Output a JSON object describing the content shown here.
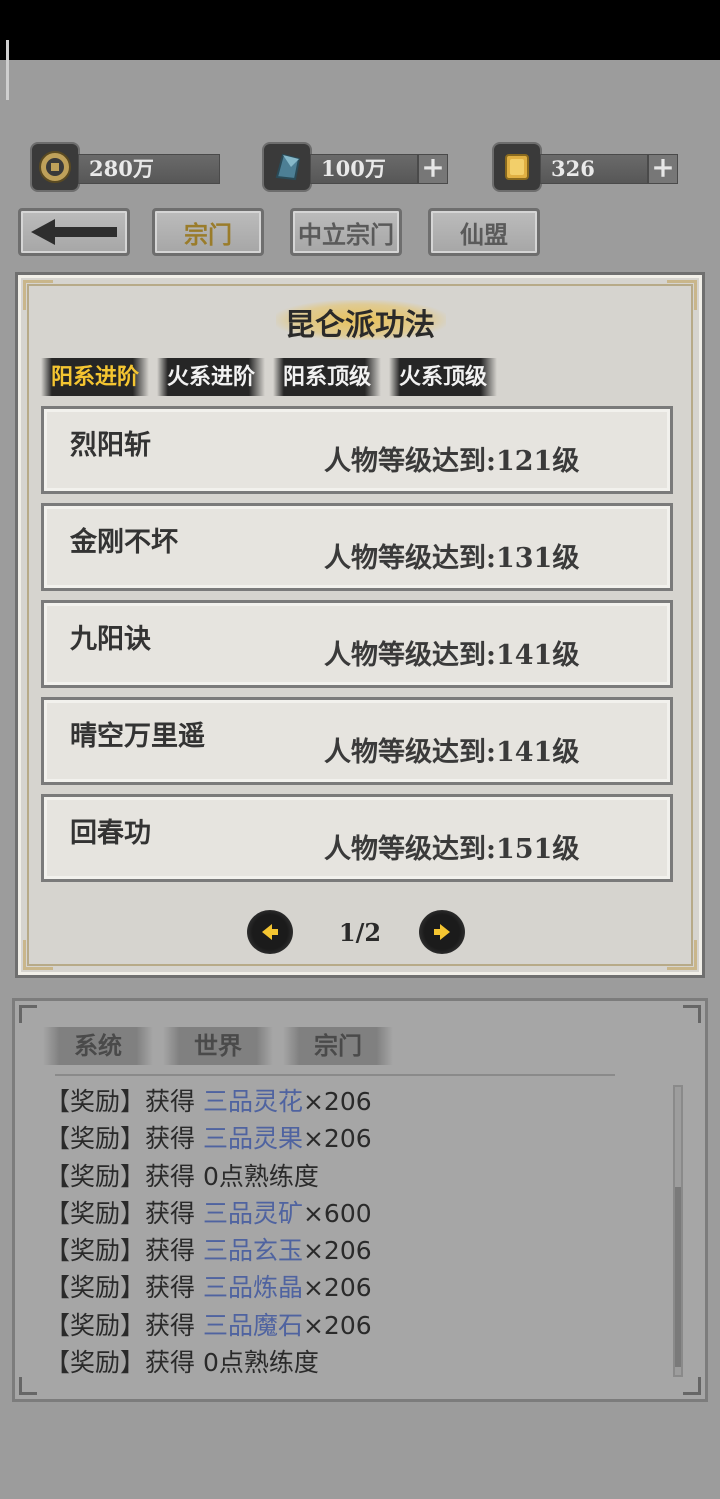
{
  "resources": [
    {
      "icon": "coin-icon",
      "value": "280万",
      "has_plus": false
    },
    {
      "icon": "crystal-icon",
      "value": "100万",
      "has_plus": true
    },
    {
      "icon": "gold-ingot-icon",
      "value": "326",
      "has_plus": true
    }
  ],
  "plus_symbol": "+",
  "nav": {
    "back_icon": "arrow-left-icon",
    "buttons": [
      "宗门",
      "中立宗门",
      "仙盟"
    ]
  },
  "panel": {
    "title": "昆仑派功法",
    "tabs": [
      "阳系进阶",
      "火系进阶",
      "阳系顶级",
      "火系顶级"
    ],
    "active_tab": 0,
    "items": [
      {
        "name": "烈阳斩",
        "requirement": "人物等级达到:121级"
      },
      {
        "name": "金刚不坏",
        "requirement": "人物等级达到:131级"
      },
      {
        "name": "九阳诀",
        "requirement": "人物等级达到:141级"
      },
      {
        "name": "晴空万里遥",
        "requirement": "人物等级达到:141级"
      },
      {
        "name": "回春功",
        "requirement": "人物等级达到:151级"
      }
    ],
    "pager": {
      "text": "1/2",
      "prev_icon": "arrow-left-icon",
      "next_icon": "arrow-right-icon"
    }
  },
  "chat": {
    "tabs": [
      "系统",
      "世界",
      "宗门"
    ],
    "lines": [
      {
        "prefix": "【奖励】获得 ",
        "item": "三品灵花",
        "suffix": "×206"
      },
      {
        "prefix": "【奖励】获得 ",
        "item": "三品灵果",
        "suffix": "×206"
      },
      {
        "prefix": "【奖励】获得 0点熟练度",
        "item": "",
        "suffix": ""
      },
      {
        "prefix": "【奖励】获得 ",
        "item": "三品灵矿",
        "suffix": "×600"
      },
      {
        "prefix": "【奖励】获得 ",
        "item": "三品玄玉",
        "suffix": "×206"
      },
      {
        "prefix": "【奖励】获得 ",
        "item": "三品炼晶",
        "suffix": "×206"
      },
      {
        "prefix": "【奖励】获得 ",
        "item": "三品魔石",
        "suffix": "×206"
      },
      {
        "prefix": "【奖励】获得 0点熟练度",
        "item": "",
        "suffix": ""
      }
    ]
  }
}
